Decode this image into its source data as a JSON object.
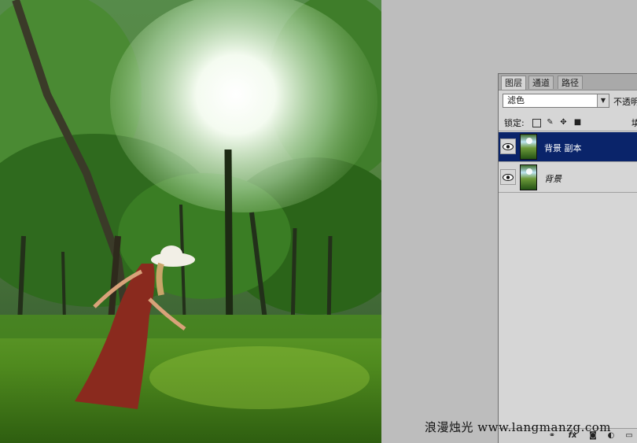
{
  "layers_panel": {
    "tabs": [
      {
        "label": "图层",
        "active": true
      },
      {
        "label": "通道",
        "active": false
      },
      {
        "label": "路径",
        "active": false
      }
    ],
    "blend_mode": "滤色",
    "opacity_label": "不透明",
    "lock_label": "锁定:",
    "fill_label": "填",
    "layers": [
      {
        "name": "背景 副本",
        "visible": true,
        "selected": true
      },
      {
        "name": "背景",
        "visible": true,
        "selected": false
      }
    ],
    "bottom_icons": [
      "link-icon",
      "fx-icon",
      "mask-icon",
      "adjustment-icon",
      "group-icon"
    ]
  },
  "watermark": "浪漫烛光 www.langmanzg.com",
  "colors": {
    "workspace": "#bdbdbd",
    "panel": "#d6d6d6",
    "selection": "#0a246a"
  }
}
